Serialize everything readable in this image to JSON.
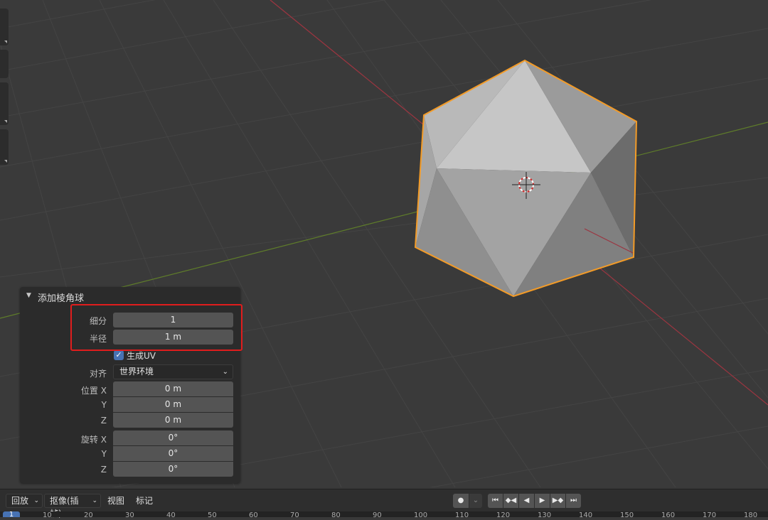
{
  "operator_panel": {
    "title": "添加棱角球",
    "subdivisions": {
      "label": "细分",
      "value": "1"
    },
    "radius": {
      "label": "半径",
      "value": "1 m"
    },
    "generate_uv": {
      "label": "生成UV",
      "checked": true
    },
    "align": {
      "label": "对齐",
      "value": "世界环境"
    },
    "location": {
      "label": "位置",
      "x_label": "X",
      "y_label": "Y",
      "z_label": "Z",
      "x": "0 m",
      "y": "0 m",
      "z": "0 m"
    },
    "rotation": {
      "label": "旋转",
      "x_label": "X",
      "y_label": "Y",
      "z_label": "Z",
      "x": "0°",
      "y": "0°",
      "z": "0°"
    }
  },
  "timeline": {
    "playback_label": "回放",
    "keying_label": "抠像(插帧)",
    "view_label": "视图",
    "marker_label": "标记",
    "current_frame": "1",
    "ruler_ticks": [
      "10",
      "20",
      "30",
      "40",
      "50",
      "60",
      "70",
      "80",
      "90",
      "100",
      "110",
      "120",
      "130",
      "140",
      "150",
      "160",
      "170",
      "180"
    ]
  },
  "colors": {
    "viewport_bg": "#3a3a3a",
    "selection_outline": "#f39b27",
    "x_axis": "#b23b46",
    "y_axis": "#6c8f2c",
    "highlight_box": "#e01d1d",
    "accent_blue": "#4772b3"
  }
}
